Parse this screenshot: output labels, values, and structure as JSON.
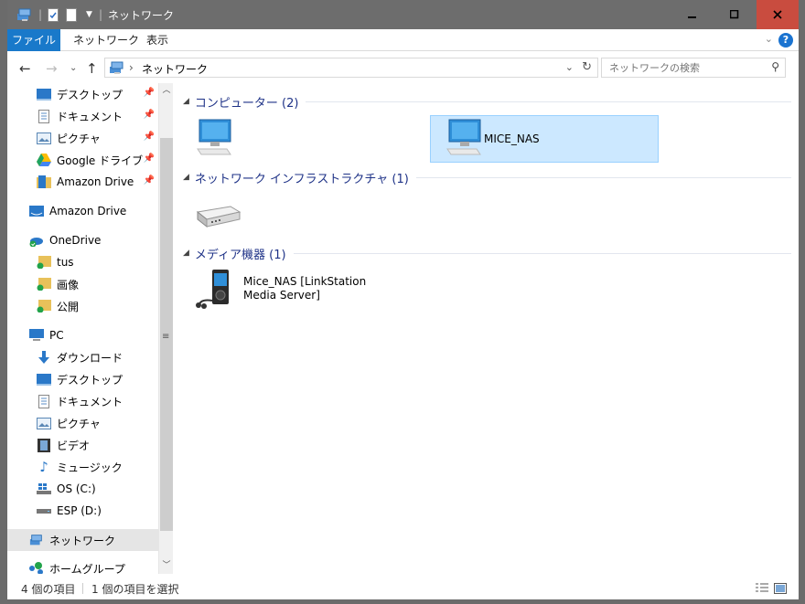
{
  "window": {
    "title": "ネットワーク"
  },
  "ribbon": {
    "tabs": [
      "ファイル",
      "ネットワーク",
      "表示"
    ],
    "help": "?"
  },
  "address": {
    "crumb": "ネットワーク"
  },
  "search": {
    "placeholder": "ネットワークの検索"
  },
  "nav": {
    "quick": [
      {
        "label": "デスクトップ",
        "icon": "desktop-icon"
      },
      {
        "label": "ドキュメント",
        "icon": "documents-icon"
      },
      {
        "label": "ピクチャ",
        "icon": "pictures-icon"
      },
      {
        "label": "Google ドライブ",
        "icon": "google-drive-icon"
      },
      {
        "label": "Amazon Drive",
        "icon": "amazon-drive-folder-icon"
      }
    ],
    "amazon_drive": "Amazon Drive",
    "onedrive": "OneDrive",
    "onedrive_children": [
      "tus",
      "画像",
      "公開"
    ],
    "pc": "PC",
    "pc_children": [
      "ダウンロード",
      "デスクトップ",
      "ドキュメント",
      "ピクチャ",
      "ビデオ",
      "ミュージック",
      "OS (C:)",
      "ESP (D:)"
    ],
    "network": "ネットワーク",
    "homegroup": "ホームグループ"
  },
  "groups": [
    {
      "title": "コンピューター (2)",
      "items": [
        {
          "label": ""
        },
        {
          "label": "MICE_NAS"
        }
      ]
    },
    {
      "title": "ネットワーク インフラストラクチャ (1)",
      "items": [
        {
          "label": ""
        }
      ]
    },
    {
      "title": "メディア機器 (1)",
      "items": [
        {
          "label": "Mice_NAS [LinkStation Media Server]"
        }
      ]
    }
  ],
  "status": {
    "count": "4 個の項目",
    "selected": "1 個の項目を選択"
  },
  "colors": {
    "accent": "#1979ca",
    "selection": "#cce8ff",
    "group_title": "#1e3287",
    "close": "#c94c3f"
  }
}
